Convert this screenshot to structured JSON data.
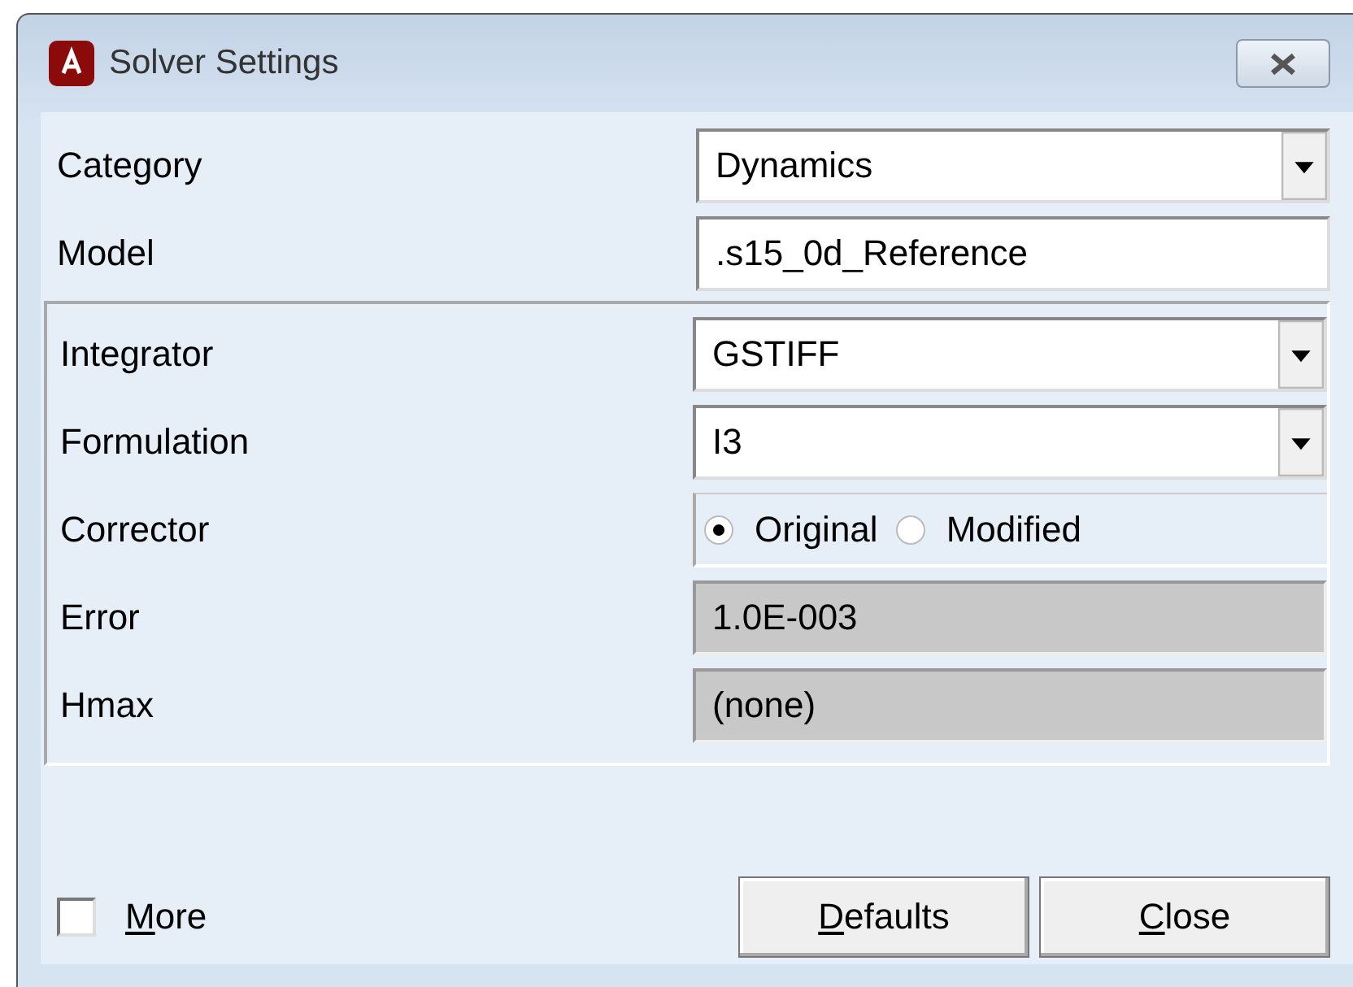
{
  "window": {
    "title": "Solver Settings"
  },
  "fields": [
    {
      "kind": "dropdown",
      "label": "Category",
      "value": "Dynamics"
    },
    {
      "kind": "text",
      "label": "Model",
      "value": ".s15_0d_Reference"
    }
  ],
  "integrator_settings": [
    {
      "kind": "dropdown",
      "label": "Integrator",
      "value": "GSTIFF"
    },
    {
      "kind": "dropdown",
      "label": "Formulation",
      "value": "I3"
    },
    {
      "kind": "radio",
      "label": "Corrector",
      "options": [
        {
          "label": "Original",
          "selected": true
        },
        {
          "label": "Modified",
          "selected": false
        }
      ]
    },
    {
      "kind": "readonly",
      "label": "Error",
      "value": "1.0E-003"
    },
    {
      "kind": "readonly",
      "label": "Hmax",
      "value": "(none)"
    }
  ],
  "more": {
    "label": "More",
    "checked": false
  },
  "buttons": [
    "Defaults",
    "Close"
  ]
}
